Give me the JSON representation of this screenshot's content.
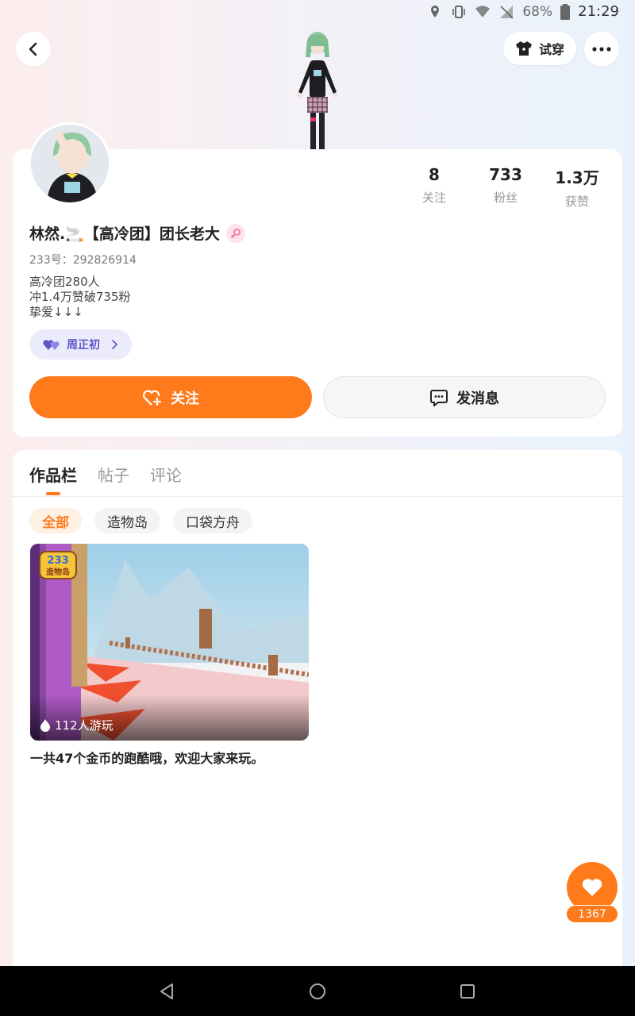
{
  "status_bar": {
    "battery": "68%",
    "time": "21:29"
  },
  "header": {
    "try_on_label": "试穿"
  },
  "profile": {
    "stats": [
      {
        "value": "8",
        "label": "关注"
      },
      {
        "value": "733",
        "label": "粉丝"
      },
      {
        "value": "1.3万",
        "label": "获赞"
      }
    ],
    "username": "林然.🚬【高冷团】团长老大",
    "uid": "233号：292826914",
    "bio": [
      "高冷团280人",
      "冲1.4万赞破735粉",
      "挚爱↓↓↓"
    ],
    "cp_name": "周正初",
    "follow_label": "关注",
    "message_label": "发消息"
  },
  "works": {
    "tabs": [
      "作品栏",
      "帖子",
      "评论"
    ],
    "filters": [
      "全部",
      "造物岛",
      "口袋方舟"
    ],
    "game": {
      "logo_top": "233",
      "logo_bottom": "造物岛",
      "plays": "112人游玩",
      "title": "一共47个金币的跑酷哦，欢迎大家来玩。"
    }
  },
  "like_fab": {
    "count": "1367"
  },
  "colors": {
    "accent": "#ff7a1a",
    "cp": "#5b54c7"
  }
}
